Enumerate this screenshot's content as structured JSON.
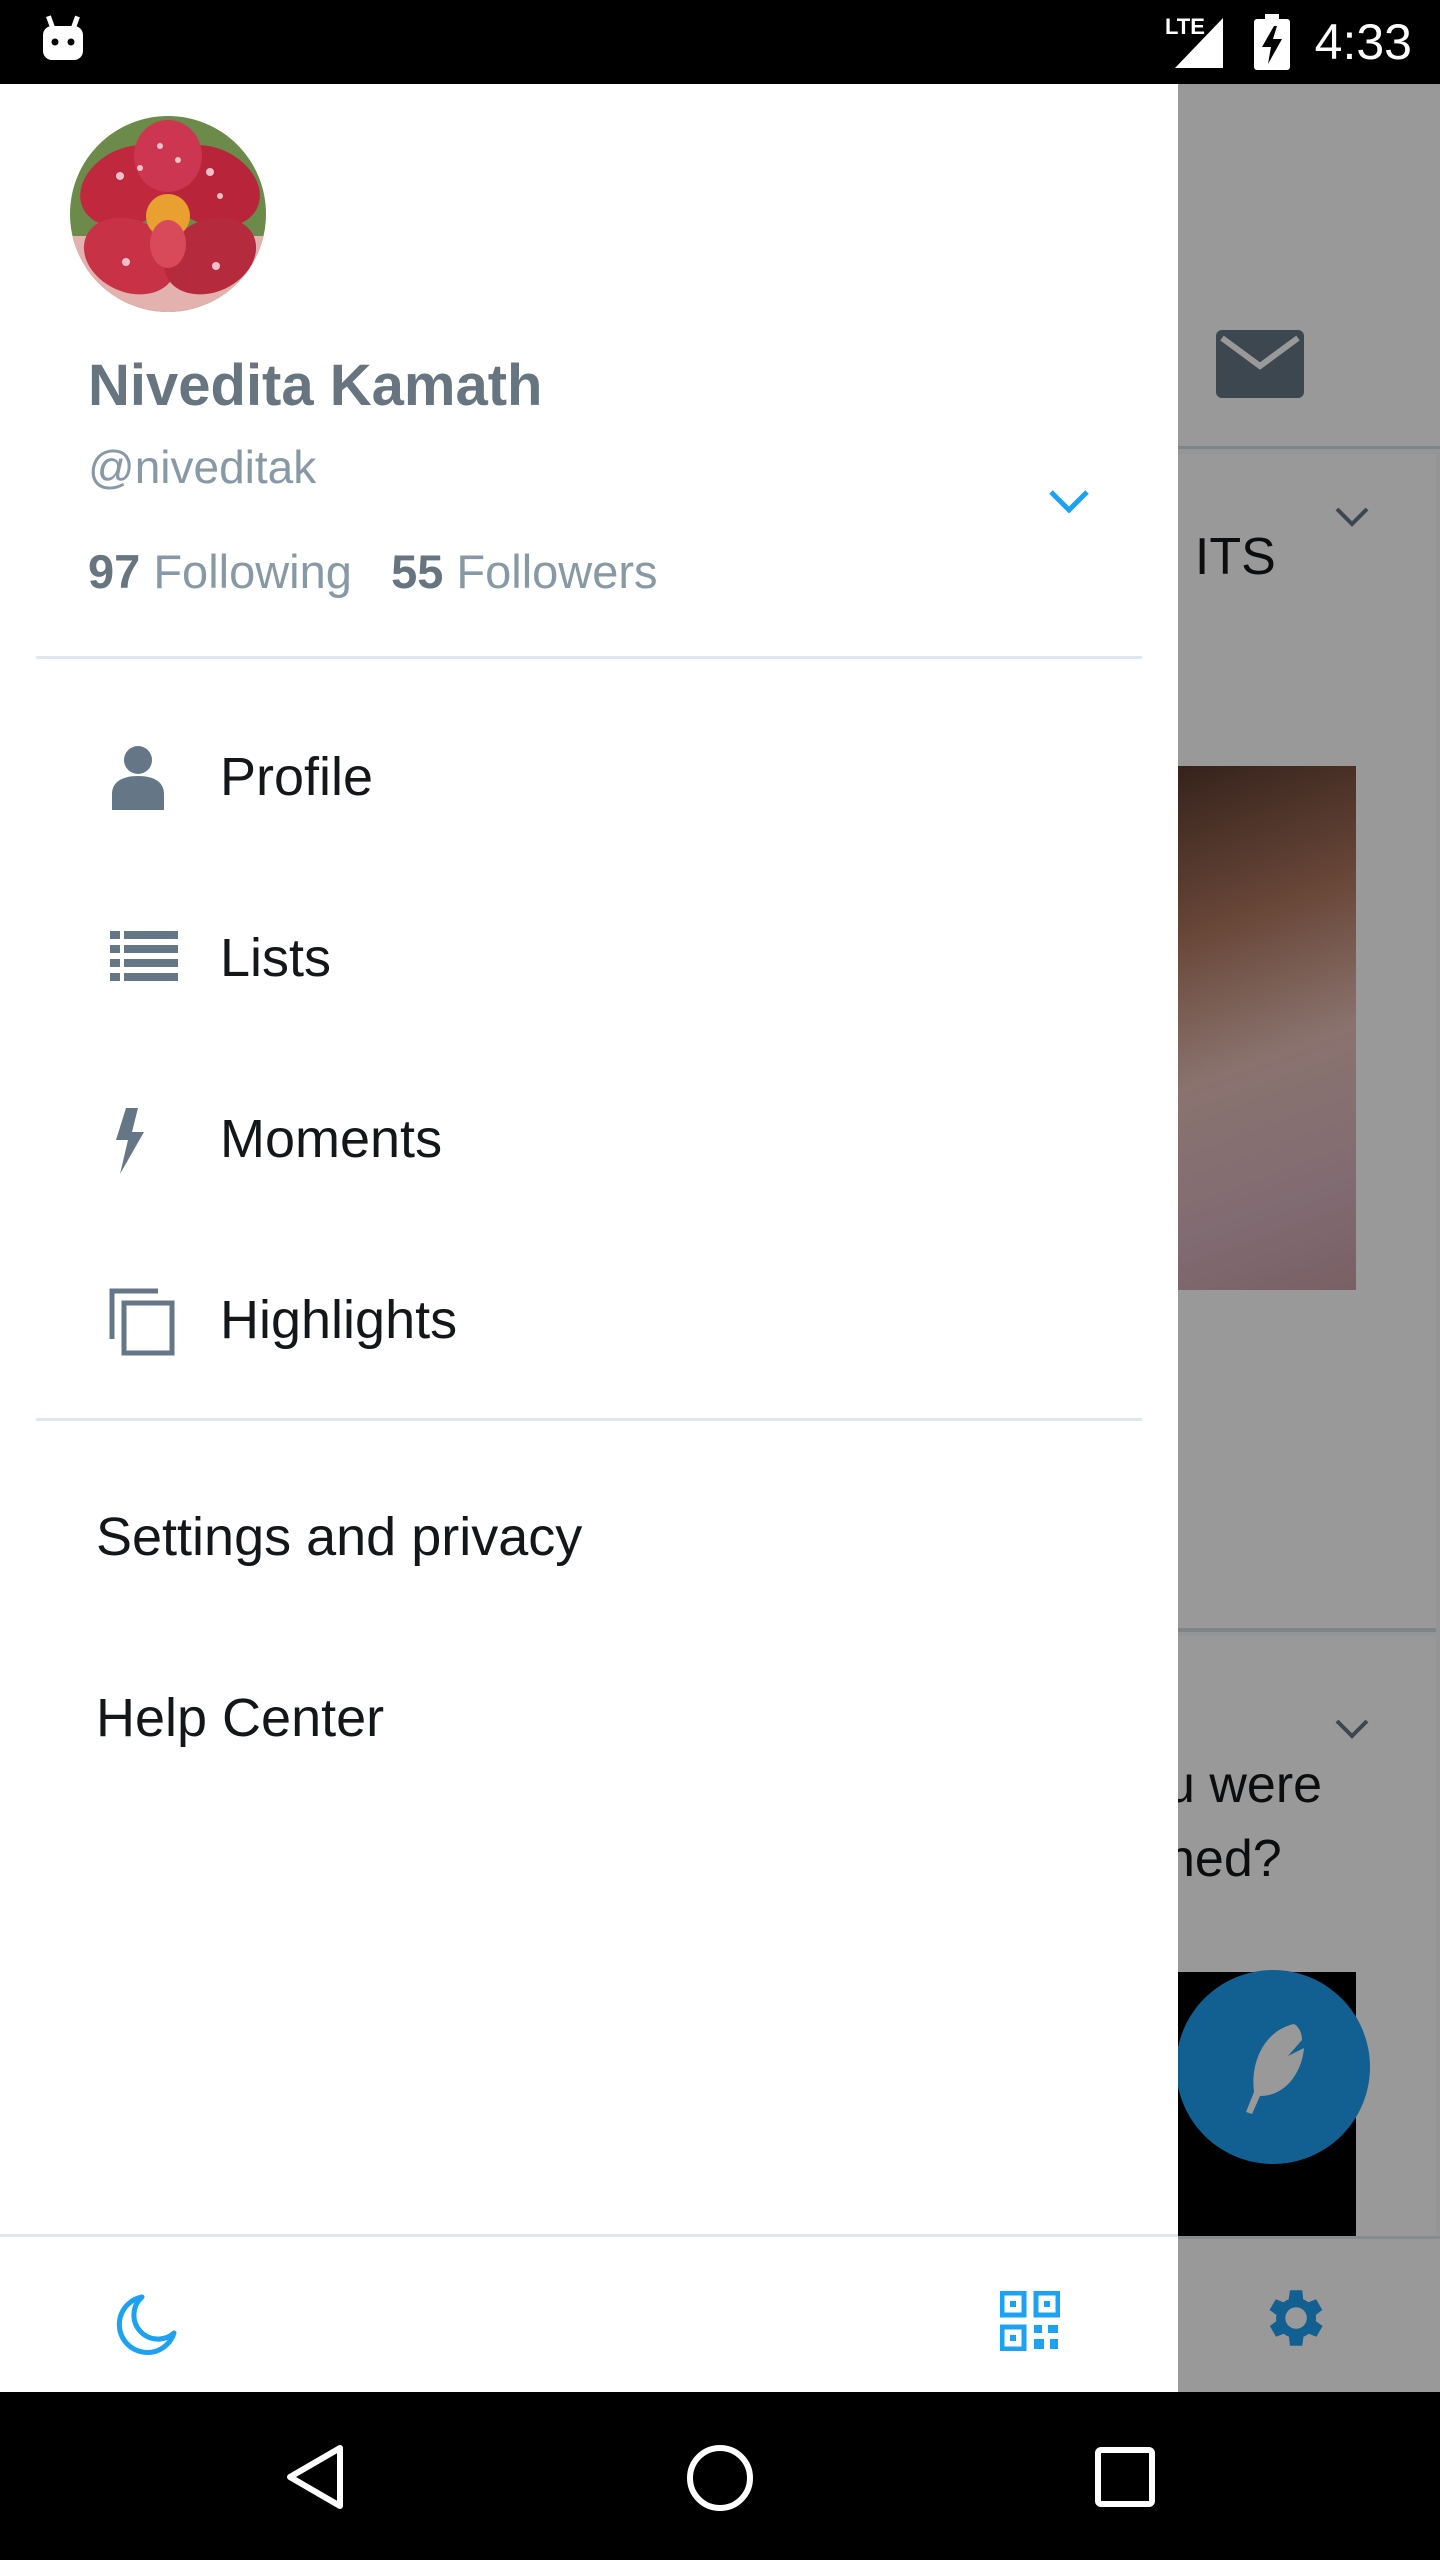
{
  "status_bar": {
    "network": "LTE",
    "time": "4:33"
  },
  "background_app": {
    "tweet1_text": "! ITS",
    "tweet2_text_line1": "u were",
    "tweet2_text_line2": "ned?"
  },
  "drawer": {
    "user": {
      "name": "Nivedita Kamath",
      "handle": "@niveditak",
      "following_count": "97",
      "following_label": "Following",
      "followers_count": "55",
      "followers_label": "Followers"
    },
    "menu": [
      {
        "label": "Profile",
        "icon": "person-icon"
      },
      {
        "label": "Lists",
        "icon": "lists-icon"
      },
      {
        "label": "Moments",
        "icon": "lightning-icon"
      },
      {
        "label": "Highlights",
        "icon": "highlights-icon"
      }
    ],
    "secondary": [
      {
        "label": "Settings and privacy"
      },
      {
        "label": "Help Center"
      }
    ],
    "footer": {
      "night_mode_icon": "moon-icon",
      "qr_icon": "qr-code-icon"
    }
  },
  "colors": {
    "accent": "#1da1f2",
    "icon_gray": "#657786",
    "text": "#14171a",
    "secondary_text": "#8899a6"
  }
}
